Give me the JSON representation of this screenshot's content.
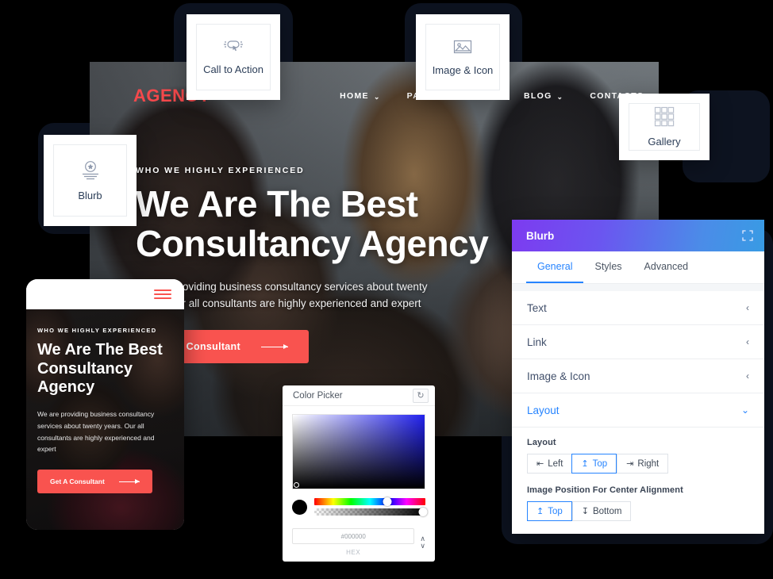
{
  "theme": {
    "background": "#000000",
    "brand_red": "#f9534f",
    "accent_blue": "#2684ff",
    "panel_gradient_from": "#7d3bf0",
    "panel_gradient_to": "#389be4",
    "picker_hue_color": "#2222ee"
  },
  "hero": {
    "logo": "AGENCY",
    "nav": [
      {
        "label": "HOME",
        "caret": "⌄"
      },
      {
        "label": "PAGES",
        "caret": "⌄"
      },
      {
        "label": "BLOG",
        "caret": "⌄"
      },
      {
        "label": "CONTACTS",
        "caret": ""
      }
    ],
    "eyebrow": "WHO WE HIGHLY EXPERIENCED",
    "title": "We Are The Best Consultancy Agency",
    "subtitle": "We are providing business consultancy services about twenty years. Our all consultants are highly experienced and expert",
    "cta_label": "Get A Consultant"
  },
  "mobile": {
    "eyebrow": "WHO WE HIGHLY EXPERIENCED",
    "title": "We Are The Best Consultancy Agency",
    "subtitle": "We are providing business consultancy services about twenty years. Our all consultants are highly experienced and expert",
    "cta_label": "Get A Consultant"
  },
  "modules": [
    {
      "label": "Call to Action",
      "icon": "click-button-icon"
    },
    {
      "label": "Image & Icon",
      "icon": "image-icon"
    },
    {
      "label": "Gallery",
      "icon": "grid-gallery-icon"
    },
    {
      "label": "Blurb",
      "icon": "badge-star-icon"
    }
  ],
  "color_picker": {
    "title": "Color Picker",
    "reset_icon": "reset-icon",
    "hex_value": "#000000",
    "hex_placeholder": "#000000",
    "format_label": "HEX",
    "swatch_color": "#000000",
    "hue_position_pct": 66,
    "alpha_position_pct": 100,
    "spinner_icon": "stepper-icon"
  },
  "panel": {
    "title": "Blurb",
    "expand_icon": "expand-icon",
    "tabs": [
      {
        "label": "General",
        "active": true
      },
      {
        "label": "Styles",
        "active": false
      },
      {
        "label": "Advanced",
        "active": false
      }
    ],
    "accordions": [
      {
        "label": "Text",
        "open": false,
        "chevron": "‹"
      },
      {
        "label": "Link",
        "open": false,
        "chevron": "‹"
      },
      {
        "label": "Image & Icon",
        "open": false,
        "chevron": "‹"
      },
      {
        "label": "Layout",
        "open": true,
        "chevron": "⌄"
      }
    ],
    "layout_field": {
      "label": "Layout",
      "options": [
        {
          "label": "Left",
          "icon": "⇤",
          "active": false
        },
        {
          "label": "Top",
          "icon": "↥",
          "active": true
        },
        {
          "label": "Right",
          "icon": "⇥",
          "active": false
        }
      ]
    },
    "image_position_field": {
      "label": "Image Position For Center Alignment",
      "options": [
        {
          "label": "Top",
          "icon": "↥",
          "active": true
        },
        {
          "label": "Bottom",
          "icon": "↧",
          "active": false
        }
      ]
    }
  }
}
